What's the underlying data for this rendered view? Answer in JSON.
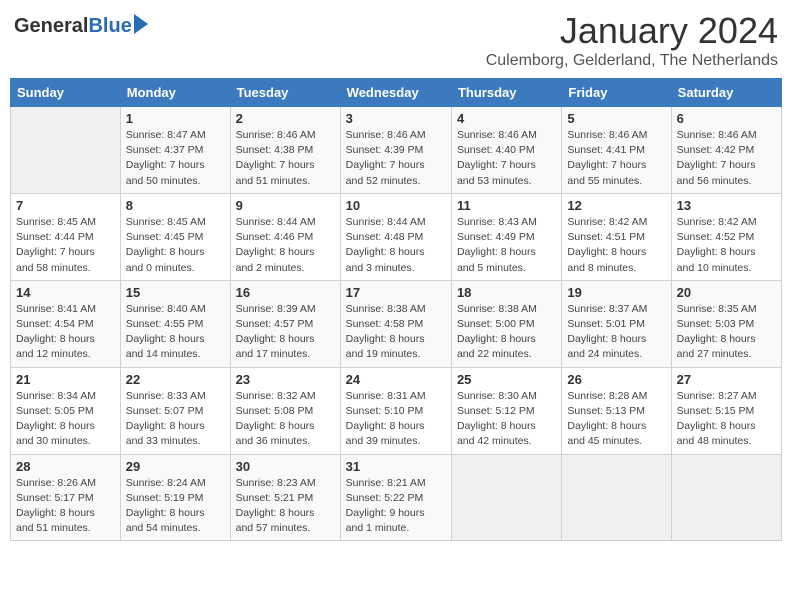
{
  "header": {
    "logo_general": "General",
    "logo_blue": "Blue",
    "title": "January 2024",
    "subtitle": "Culemborg, Gelderland, The Netherlands"
  },
  "days_of_week": [
    "Sunday",
    "Monday",
    "Tuesday",
    "Wednesday",
    "Thursday",
    "Friday",
    "Saturday"
  ],
  "weeks": [
    {
      "days": [
        {
          "number": "",
          "info": "",
          "empty": true
        },
        {
          "number": "1",
          "info": "Sunrise: 8:47 AM\nSunset: 4:37 PM\nDaylight: 7 hours\nand 50 minutes."
        },
        {
          "number": "2",
          "info": "Sunrise: 8:46 AM\nSunset: 4:38 PM\nDaylight: 7 hours\nand 51 minutes."
        },
        {
          "number": "3",
          "info": "Sunrise: 8:46 AM\nSunset: 4:39 PM\nDaylight: 7 hours\nand 52 minutes."
        },
        {
          "number": "4",
          "info": "Sunrise: 8:46 AM\nSunset: 4:40 PM\nDaylight: 7 hours\nand 53 minutes."
        },
        {
          "number": "5",
          "info": "Sunrise: 8:46 AM\nSunset: 4:41 PM\nDaylight: 7 hours\nand 55 minutes."
        },
        {
          "number": "6",
          "info": "Sunrise: 8:46 AM\nSunset: 4:42 PM\nDaylight: 7 hours\nand 56 minutes."
        }
      ]
    },
    {
      "days": [
        {
          "number": "7",
          "info": "Sunrise: 8:45 AM\nSunset: 4:44 PM\nDaylight: 7 hours\nand 58 minutes."
        },
        {
          "number": "8",
          "info": "Sunrise: 8:45 AM\nSunset: 4:45 PM\nDaylight: 8 hours\nand 0 minutes."
        },
        {
          "number": "9",
          "info": "Sunrise: 8:44 AM\nSunset: 4:46 PM\nDaylight: 8 hours\nand 2 minutes."
        },
        {
          "number": "10",
          "info": "Sunrise: 8:44 AM\nSunset: 4:48 PM\nDaylight: 8 hours\nand 3 minutes."
        },
        {
          "number": "11",
          "info": "Sunrise: 8:43 AM\nSunset: 4:49 PM\nDaylight: 8 hours\nand 5 minutes."
        },
        {
          "number": "12",
          "info": "Sunrise: 8:42 AM\nSunset: 4:51 PM\nDaylight: 8 hours\nand 8 minutes."
        },
        {
          "number": "13",
          "info": "Sunrise: 8:42 AM\nSunset: 4:52 PM\nDaylight: 8 hours\nand 10 minutes."
        }
      ]
    },
    {
      "days": [
        {
          "number": "14",
          "info": "Sunrise: 8:41 AM\nSunset: 4:54 PM\nDaylight: 8 hours\nand 12 minutes."
        },
        {
          "number": "15",
          "info": "Sunrise: 8:40 AM\nSunset: 4:55 PM\nDaylight: 8 hours\nand 14 minutes."
        },
        {
          "number": "16",
          "info": "Sunrise: 8:39 AM\nSunset: 4:57 PM\nDaylight: 8 hours\nand 17 minutes."
        },
        {
          "number": "17",
          "info": "Sunrise: 8:38 AM\nSunset: 4:58 PM\nDaylight: 8 hours\nand 19 minutes."
        },
        {
          "number": "18",
          "info": "Sunrise: 8:38 AM\nSunset: 5:00 PM\nDaylight: 8 hours\nand 22 minutes."
        },
        {
          "number": "19",
          "info": "Sunrise: 8:37 AM\nSunset: 5:01 PM\nDaylight: 8 hours\nand 24 minutes."
        },
        {
          "number": "20",
          "info": "Sunrise: 8:35 AM\nSunset: 5:03 PM\nDaylight: 8 hours\nand 27 minutes."
        }
      ]
    },
    {
      "days": [
        {
          "number": "21",
          "info": "Sunrise: 8:34 AM\nSunset: 5:05 PM\nDaylight: 8 hours\nand 30 minutes."
        },
        {
          "number": "22",
          "info": "Sunrise: 8:33 AM\nSunset: 5:07 PM\nDaylight: 8 hours\nand 33 minutes."
        },
        {
          "number": "23",
          "info": "Sunrise: 8:32 AM\nSunset: 5:08 PM\nDaylight: 8 hours\nand 36 minutes."
        },
        {
          "number": "24",
          "info": "Sunrise: 8:31 AM\nSunset: 5:10 PM\nDaylight: 8 hours\nand 39 minutes."
        },
        {
          "number": "25",
          "info": "Sunrise: 8:30 AM\nSunset: 5:12 PM\nDaylight: 8 hours\nand 42 minutes."
        },
        {
          "number": "26",
          "info": "Sunrise: 8:28 AM\nSunset: 5:13 PM\nDaylight: 8 hours\nand 45 minutes."
        },
        {
          "number": "27",
          "info": "Sunrise: 8:27 AM\nSunset: 5:15 PM\nDaylight: 8 hours\nand 48 minutes."
        }
      ]
    },
    {
      "days": [
        {
          "number": "28",
          "info": "Sunrise: 8:26 AM\nSunset: 5:17 PM\nDaylight: 8 hours\nand 51 minutes."
        },
        {
          "number": "29",
          "info": "Sunrise: 8:24 AM\nSunset: 5:19 PM\nDaylight: 8 hours\nand 54 minutes."
        },
        {
          "number": "30",
          "info": "Sunrise: 8:23 AM\nSunset: 5:21 PM\nDaylight: 8 hours\nand 57 minutes."
        },
        {
          "number": "31",
          "info": "Sunrise: 8:21 AM\nSunset: 5:22 PM\nDaylight: 9 hours\nand 1 minute."
        },
        {
          "number": "",
          "info": "",
          "empty": true
        },
        {
          "number": "",
          "info": "",
          "empty": true
        },
        {
          "number": "",
          "info": "",
          "empty": true
        }
      ]
    }
  ]
}
